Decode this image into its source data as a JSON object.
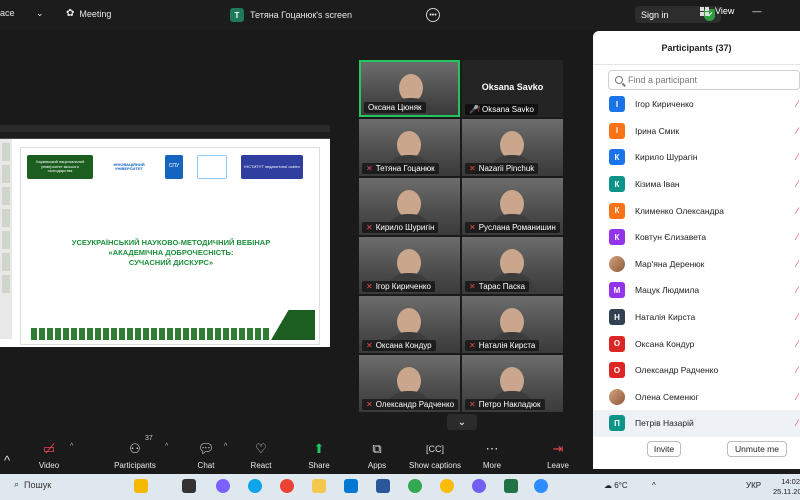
{
  "topbar": {
    "app_partial": "ace",
    "meeting_label": "Meeting",
    "screen_badge": "T",
    "screen_title": "Тетяна Гоцанюк's screen",
    "sign_in": "Sign in",
    "view": "View"
  },
  "slide": {
    "title_line1": "УСЕУКРАЇНСЬКИЙ НАУКОВО-МЕТОДИЧНИЙ ВЕБІНАР",
    "title_line2": "«АКАДЕМІЧНА ДОБРОЧЕСНІСТЬ:",
    "title_line3": "СУЧАСНИЙ ДИСКУРС»",
    "logo1": "Харківський національний університет міського господарства",
    "logo2": "ІННОВАЦІЙНИЙ УНІВЕРСИТЕТ",
    "logo3": "СПУ",
    "logo5": "ІНСТИТУТ педагогічної освіти"
  },
  "gallery": {
    "tiles": [
      {
        "name": "Оксана Цюняк",
        "muted": false
      },
      {
        "name": "Oksana Savko",
        "muted": true,
        "big": "Oksana Savko"
      },
      {
        "name": "Тетяна Гоцанюк",
        "muted": true
      },
      {
        "name": "Nazarii Pinchuk",
        "muted": true
      },
      {
        "name": "Кирило Шуригін",
        "muted": true
      },
      {
        "name": "Руслана Романишин",
        "muted": true
      },
      {
        "name": "Ігор Кириченко",
        "muted": true
      },
      {
        "name": "Тарас Паска",
        "muted": true
      },
      {
        "name": "Оксана Кондур",
        "muted": true
      },
      {
        "name": "Наталія Кирста",
        "muted": true
      },
      {
        "name": "Олександр Радченко",
        "muted": true
      },
      {
        "name": "Петро Накладюк",
        "muted": true
      }
    ]
  },
  "panel": {
    "title": "Participants (37)",
    "search_placeholder": "Find a participant",
    "invite": "Invite",
    "unmute": "Unmute me",
    "participants": [
      {
        "initial": "І",
        "name": "Ігор Кириченко",
        "color": "#1a73e8"
      },
      {
        "initial": "І",
        "name": "Ірина Смик",
        "color": "#f97316"
      },
      {
        "initial": "К",
        "name": "Кирило Шурагін",
        "color": "#1a73e8"
      },
      {
        "initial": "К",
        "name": "Кізима Іван",
        "color": "#0d9488"
      },
      {
        "initial": "К",
        "name": "Клименко Олександра",
        "color": "#f97316"
      },
      {
        "initial": "К",
        "name": "Ковтун Єлизавета",
        "color": "#9333ea"
      },
      {
        "initial": "",
        "name": "Мар'яна Деренюк",
        "color": "#8d5a3b",
        "photo": true
      },
      {
        "initial": "М",
        "name": "Мацук Людмила",
        "color": "#9333ea"
      },
      {
        "initial": "Н",
        "name": "Наталія Кирста",
        "color": "#334155"
      },
      {
        "initial": "О",
        "name": "Оксана Кондур",
        "color": "#dc2626"
      },
      {
        "initial": "О",
        "name": "Олександр Радченко",
        "color": "#dc2626"
      },
      {
        "initial": "",
        "name": "Олена Семенюг",
        "color": "#8d5a3b",
        "photo": true
      },
      {
        "initial": "П",
        "name": "Петрів Назарій",
        "color": "#0d9488"
      }
    ]
  },
  "toolbar": {
    "video": "Video",
    "participants": "Participants",
    "participants_count": "37",
    "chat": "Chat",
    "react": "React",
    "share": "Share",
    "apps": "Apps",
    "captions": "Show captions",
    "more": "More",
    "leave": "Leave"
  },
  "taskbar": {
    "search": "Пошук",
    "temp": "6°C",
    "lang": "УКР",
    "time": "14:02",
    "date": "25.11.20"
  }
}
